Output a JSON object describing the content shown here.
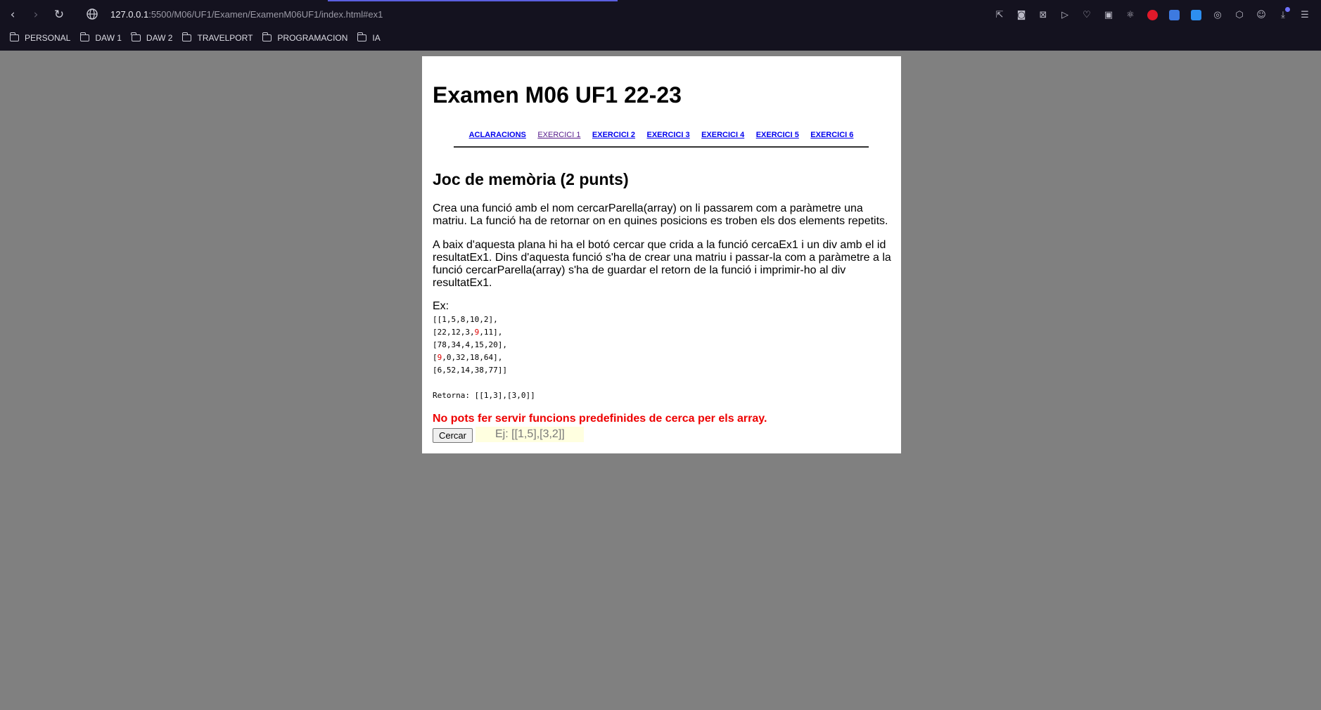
{
  "browser": {
    "url_host": "127.0.0.1",
    "url_path": ":5500/M06/UF1/Examen/ExamenM06UF1/index.html#ex1",
    "bookmarks": [
      {
        "label": "PERSONAL"
      },
      {
        "label": "DAW 1"
      },
      {
        "label": "DAW 2"
      },
      {
        "label": "TRAVELPORT"
      },
      {
        "label": "PROGRAMACION"
      },
      {
        "label": "IA"
      }
    ]
  },
  "page": {
    "title": "Examen M06 UF1 22-23",
    "menu": [
      {
        "label": "ACLARACIONS"
      },
      {
        "label": "EXERCICI 1"
      },
      {
        "label": "EXERCICI 2"
      },
      {
        "label": "EXERCICI 3"
      },
      {
        "label": "EXERCICI 4"
      },
      {
        "label": "EXERCICI 5"
      },
      {
        "label": "EXERCICI 6"
      }
    ],
    "exercise_title": "Joc de memòria (2 punts)",
    "paragraph_1": "Crea una funció amb el nom cercarParella(array) on li passarem com a paràmetre una matriu. La funció ha de retornar on en quines posicions es troben els dos elements repetits.",
    "paragraph_2": "A baix d'aquesta plana hi ha el botó cercar que crida a la funció cercaEx1 i un div amb el id resultatEx1. Dins d'aquesta funció s'ha de crear una matriu i passar-la com a paràmetre a la funció cercarParella(array) s'ha de guardar el retorn de la funció i imprimir-ho al div resultatEx1.",
    "example_label": "Ex:",
    "matrix_lines": {
      "l1": "[[1,5,8,10,2],",
      "l2_a": "[22,12,3,",
      "l2_b": "9",
      "l2_c": ",11],",
      "l3": "[78,34,4,15,20],",
      "l4_a": "[",
      "l4_b": "9",
      "l4_c": ",0,32,18,64],",
      "l5": "[6,52,14,38,77]]"
    },
    "returns_text": "Retorna: [[1,3],[3,0]]",
    "warning": "No pots fer servir funcions predefinides de cerca per els array.",
    "search_button": "Cercar",
    "result_placeholder": "Ej: [[1,5],[3,2]]",
    "colors": {
      "warning": "#ee0000",
      "result_bg": "#ffffe0",
      "link": "#0000ee",
      "visited_link": "#551a8b",
      "page_bg": "#808080"
    }
  }
}
